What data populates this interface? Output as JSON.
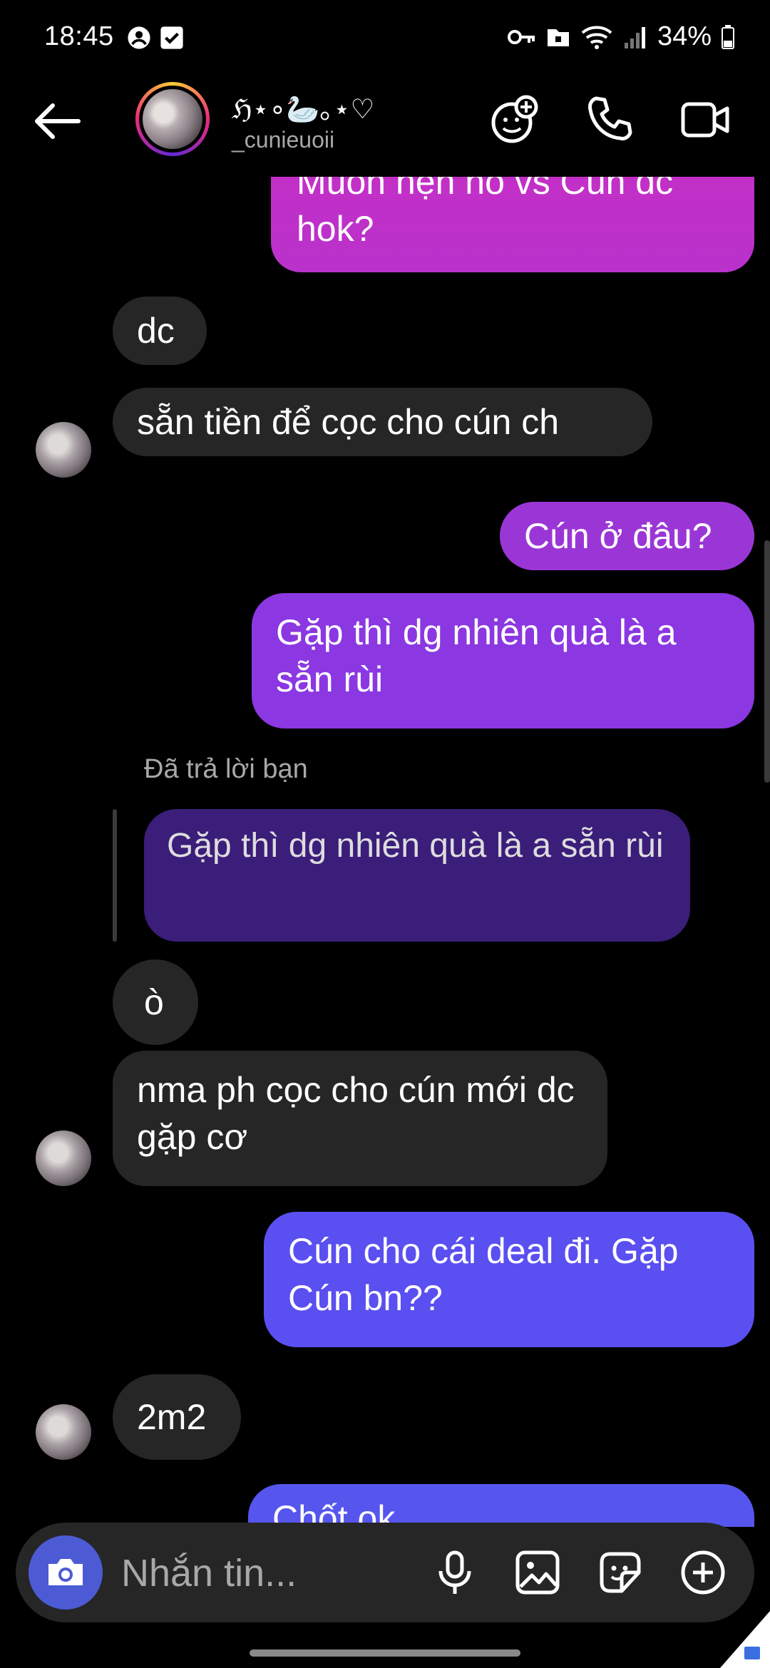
{
  "status_bar": {
    "time": "18:45",
    "battery": "34%"
  },
  "header": {
    "display_name": "ℌ⋆∘🦢｡⋆♡",
    "username": "_cunieuoii",
    "icons": [
      "add-effects-icon",
      "phone-icon",
      "video-camera-icon"
    ]
  },
  "messages": [
    {
      "from": "me",
      "text": "Muốn hẹn hò vs Cún dc hok?"
    },
    {
      "from": "them",
      "text": "dc"
    },
    {
      "from": "them",
      "text": "sẵn tiền để cọc cho cún ch"
    },
    {
      "from": "me",
      "text": "Cún ở đâu?"
    },
    {
      "from": "me",
      "text": "Gặp thì dg nhiên quà là a sẵn rùi"
    },
    {
      "reply_label": "Đã trả lời bạn",
      "quoted": "Gặp thì dg nhiên quà là a sẵn rùi"
    },
    {
      "from": "them",
      "text": "ò"
    },
    {
      "from": "them",
      "text": "nma ph cọc cho cún mới dc gặp cơ"
    },
    {
      "from": "me",
      "text": "Cún cho cái deal đi. Gặp Cún bn??"
    },
    {
      "from": "them",
      "text": "2m2"
    },
    {
      "from": "me",
      "text": "Chốt ok..."
    }
  ],
  "composer": {
    "placeholder": "Nhắn tin..."
  },
  "colors": {
    "outgoing_gradient_top": "#c32fc4",
    "outgoing_gradient_mid": "#8b3be6",
    "outgoing_gradient_bottom": "#5a4ff0",
    "incoming": "#262626",
    "quoted": "#3b1d7a",
    "camera_button": "#4c5bd4"
  }
}
